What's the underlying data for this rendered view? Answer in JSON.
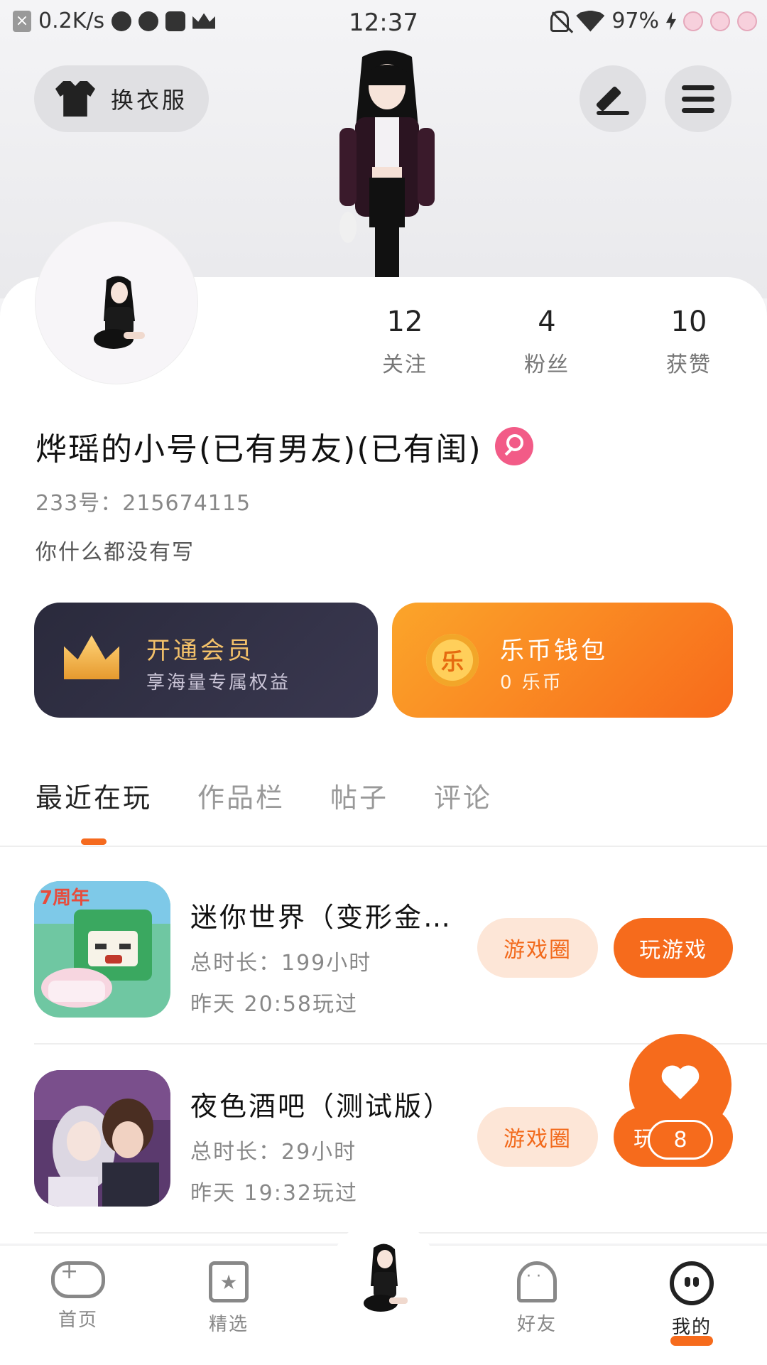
{
  "status_bar": {
    "net_speed": "0.2K/s",
    "time": "12:37",
    "battery": "97%"
  },
  "header": {
    "outfit_label": "换衣服",
    "icons": [
      "shirt-icon",
      "pen-icon",
      "menu-icon"
    ]
  },
  "profile": {
    "stats": [
      {
        "value": "12",
        "label": "关注"
      },
      {
        "value": "4",
        "label": "粉丝"
      },
      {
        "value": "10",
        "label": "获赞"
      }
    ],
    "username": "烨瑶的小号(已有男友)(已有闺)",
    "user_id": "233号：215674115",
    "bio": "你什么都没有写"
  },
  "vip": {
    "title": "开通会员",
    "subtitle": "享海量专属权益"
  },
  "wallet": {
    "coin_glyph": "乐",
    "title": "乐币钱包",
    "subtitle": "0 乐币"
  },
  "tabs": [
    "最近在玩",
    "作品栏",
    "帖子",
    "评论"
  ],
  "games": [
    {
      "name": "迷你世界（变形金…",
      "total_time": "总时长：199小时",
      "last_played": "昨天 20:58玩过",
      "circle_label": "游戏圈",
      "play_label": "玩游戏",
      "icon_badge": "7周年"
    },
    {
      "name": "夜色酒吧（测试版）",
      "total_time": "总时长：29小时",
      "last_played": "昨天 19:32玩过",
      "circle_label": "游戏圈",
      "play_label": "玩"
    }
  ],
  "like_fab": {
    "count": "8"
  },
  "bottom_nav": [
    {
      "label": "首页",
      "icon": "gamepad-icon"
    },
    {
      "label": "精选",
      "icon": "star-icon"
    },
    {
      "label": "好友",
      "icon": "ghost-icon"
    },
    {
      "label": "我的",
      "icon": "me-icon"
    }
  ],
  "colors": {
    "accent": "#f66b1c",
    "vip_gold": "#f3c16a",
    "vip_bg": "#2a2a3c",
    "gender_pink": "#f25b87"
  }
}
